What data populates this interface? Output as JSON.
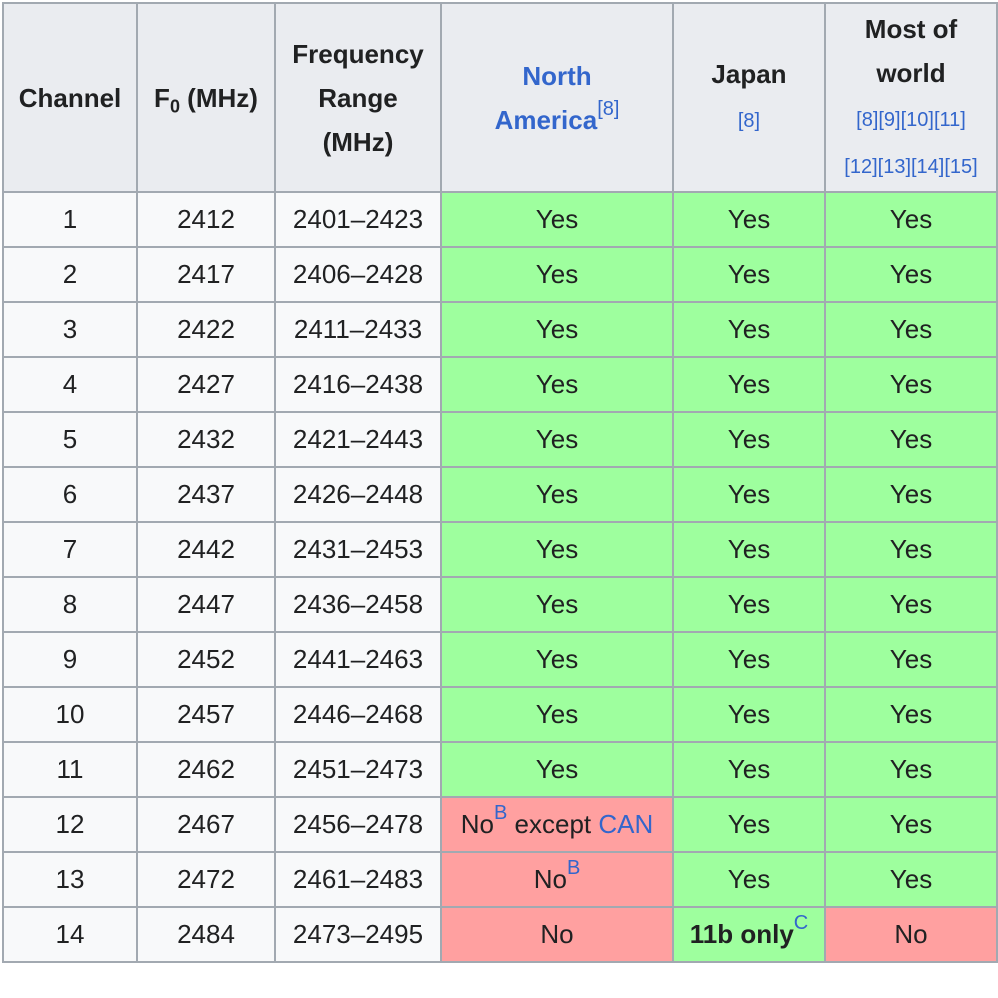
{
  "headers": {
    "channel": "Channel",
    "f0_main": "F",
    "f0_sub": "0",
    "f0_unit": " (MHz)",
    "range_l1": "Frequency",
    "range_l2": "Range",
    "range_l3": "(MHz)",
    "na_l1": "North",
    "na_l2": "America",
    "na_ref": "[8]",
    "jp_l1": "Japan",
    "jp_ref": "[8]",
    "mow_l1": "Most of",
    "mow_l2": "world",
    "mow_refs1": "[8][9][10][11]",
    "mow_refs2": "[12][13][14][15]"
  },
  "rows": [
    {
      "channel": "1",
      "f0": "2412",
      "range": "2401–2423",
      "na": "Yes",
      "jp": "Yes",
      "mow": "Yes"
    },
    {
      "channel": "2",
      "f0": "2417",
      "range": "2406–2428",
      "na": "Yes",
      "jp": "Yes",
      "mow": "Yes"
    },
    {
      "channel": "3",
      "f0": "2422",
      "range": "2411–2433",
      "na": "Yes",
      "jp": "Yes",
      "mow": "Yes"
    },
    {
      "channel": "4",
      "f0": "2427",
      "range": "2416–2438",
      "na": "Yes",
      "jp": "Yes",
      "mow": "Yes"
    },
    {
      "channel": "5",
      "f0": "2432",
      "range": "2421–2443",
      "na": "Yes",
      "jp": "Yes",
      "mow": "Yes"
    },
    {
      "channel": "6",
      "f0": "2437",
      "range": "2426–2448",
      "na": "Yes",
      "jp": "Yes",
      "mow": "Yes"
    },
    {
      "channel": "7",
      "f0": "2442",
      "range": "2431–2453",
      "na": "Yes",
      "jp": "Yes",
      "mow": "Yes"
    },
    {
      "channel": "8",
      "f0": "2447",
      "range": "2436–2458",
      "na": "Yes",
      "jp": "Yes",
      "mow": "Yes"
    },
    {
      "channel": "9",
      "f0": "2452",
      "range": "2441–2463",
      "na": "Yes",
      "jp": "Yes",
      "mow": "Yes"
    },
    {
      "channel": "10",
      "f0": "2457",
      "range": "2446–2468",
      "na": "Yes",
      "jp": "Yes",
      "mow": "Yes"
    },
    {
      "channel": "11",
      "f0": "2462",
      "range": "2451–2473",
      "na": "Yes",
      "jp": "Yes",
      "mow": "Yes"
    },
    {
      "channel": "12",
      "f0": "2467",
      "range": "2456–2478",
      "na_no": "No",
      "na_note": "B",
      "na_except": " except ",
      "na_can": "CAN",
      "jp": "Yes",
      "mow": "Yes"
    },
    {
      "channel": "13",
      "f0": "2472",
      "range": "2461–2483",
      "na_no": "No",
      "na_note": "B",
      "jp": "Yes",
      "mow": "Yes"
    },
    {
      "channel": "14",
      "f0": "2484",
      "range": "2473–2495",
      "na": "No",
      "jp_bold": "11b only",
      "jp_note": "C",
      "mow": "No"
    }
  ],
  "colors": {
    "yes": "#9eff9e",
    "no": "#ffa0a0",
    "header": "#eaecf0",
    "link": "#3366cc"
  }
}
